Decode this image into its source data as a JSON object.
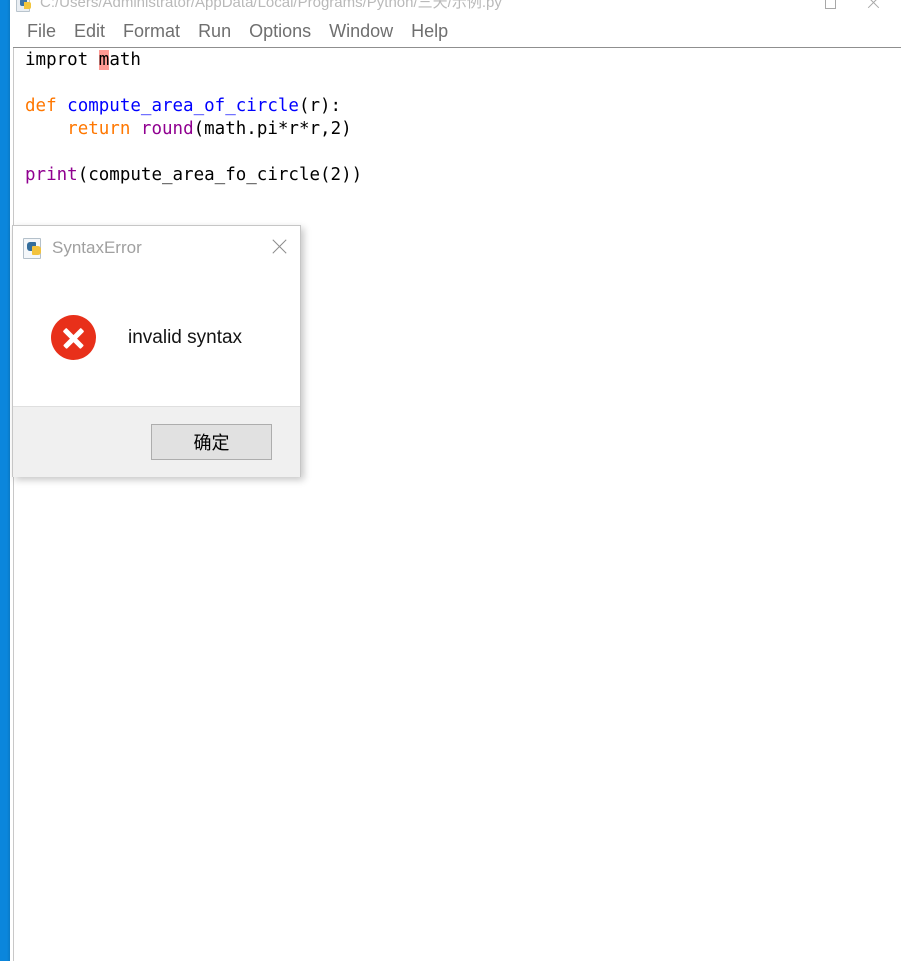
{
  "window": {
    "title": "C:/Users/Administrator/AppData/Local/Programs/Python/三天/示例.py",
    "app_icon": "python-file-icon",
    "controls": {
      "maximize_label": "maximize-icon",
      "close_label": "close-icon"
    }
  },
  "menu": {
    "items": [
      {
        "label": "File"
      },
      {
        "label": "Edit"
      },
      {
        "label": "Format"
      },
      {
        "label": "Run"
      },
      {
        "label": "Options"
      },
      {
        "label": "Window"
      },
      {
        "label": "Help"
      }
    ]
  },
  "editor": {
    "lines": [
      {
        "id": "line-1",
        "segments": [
          {
            "text": "improt ",
            "style": "plain"
          },
          {
            "text": "m",
            "style": "error"
          },
          {
            "text": "ath",
            "style": "plain"
          }
        ]
      },
      {
        "id": "line-2",
        "segments": [
          {
            "text": "",
            "style": "plain"
          }
        ]
      },
      {
        "id": "line-3",
        "segments": [
          {
            "text": "def ",
            "style": "keyword"
          },
          {
            "text": "compute_area_of_circle",
            "style": "defname"
          },
          {
            "text": "(r):",
            "style": "plain"
          }
        ]
      },
      {
        "id": "line-4",
        "segments": [
          {
            "text": "    ",
            "style": "plain"
          },
          {
            "text": "return ",
            "style": "keyword"
          },
          {
            "text": "round",
            "style": "builtin"
          },
          {
            "text": "(math.pi*r*r,2)",
            "style": "plain"
          }
        ]
      },
      {
        "id": "line-5",
        "segments": [
          {
            "text": "",
            "style": "plain"
          }
        ]
      },
      {
        "id": "line-6",
        "segments": [
          {
            "text": "print",
            "style": "builtin"
          },
          {
            "text": "(compute_area_fo_circle(2))",
            "style": "plain"
          }
        ]
      }
    ]
  },
  "dialog": {
    "title": "SyntaxError",
    "icon": "python-file-icon",
    "close_label": "close-icon",
    "error_icon": "error-x-icon",
    "message": "invalid syntax",
    "ok_label": "确定"
  },
  "colors": {
    "accent_blue": "#0b86dc",
    "error_red": "#e8301a",
    "keyword_orange": "#ff7700",
    "defname_blue": "#0000ff",
    "builtin_purple": "#900090",
    "error_highlight": "#ff9a94",
    "dialog_footer": "#f0f0f0"
  }
}
